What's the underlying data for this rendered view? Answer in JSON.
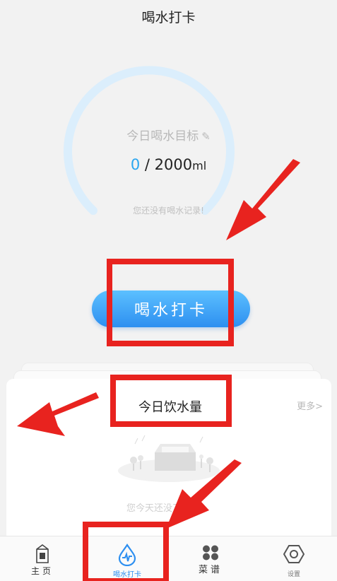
{
  "header": {
    "title": "喝水打卡"
  },
  "gauge": {
    "label": "今日喝水目标",
    "edit_icon": "edit-icon",
    "current": "0",
    "separator": " / ",
    "target": "2000",
    "unit": "ml",
    "empty_text": "您还没有喝水记录!"
  },
  "checkin_button": {
    "label": "喝水打卡"
  },
  "today_card": {
    "title": "今日饮水量",
    "more": "更多>",
    "empty_text": "您今天还没了"
  },
  "tabbar": {
    "items": [
      {
        "label": "主页",
        "icon": "milk-carton-icon"
      },
      {
        "label": "喝水打卡",
        "icon": "water-drop-icon"
      },
      {
        "label": "菜谱",
        "icon": "grid-dots-icon"
      },
      {
        "label": "设置",
        "icon": "hexagon-gear-icon"
      }
    ]
  },
  "colors": {
    "accent": "#2d8ff0",
    "highlight": "#e8231f",
    "gauge_track": "#dbeefc"
  }
}
